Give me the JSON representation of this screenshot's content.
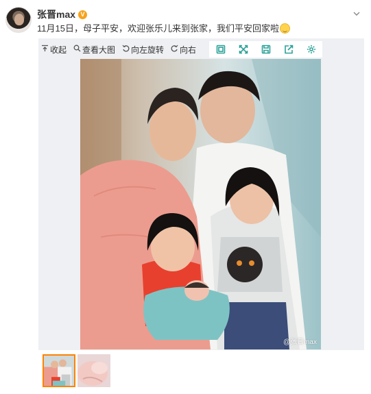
{
  "post": {
    "username": "张晋max",
    "verified_badge": "V",
    "text": "11月15日，母子平安，欢迎张乐儿来到张家，我们平安回家啦",
    "emoji": "smile-emoji"
  },
  "toolbar": {
    "collapse_label": "收起",
    "view_large_label": "查看大图",
    "rotate_left_label": "向左旋转",
    "rotate_right_label": "向右"
  },
  "photo": {
    "watermark": "@张晋max"
  },
  "icons": {
    "toolbar": [
      "collapse-icon",
      "zoom-icon",
      "rotate-left-icon",
      "rotate-right-icon"
    ],
    "icon_bar": [
      "frame-icon",
      "expand-icon",
      "save-icon",
      "share-icon",
      "settings-icon"
    ],
    "header": [
      "avatar",
      "verified-icon",
      "chevron-down-icon"
    ]
  },
  "colors": {
    "accent": "#2aa198",
    "badge": "#f7a21b",
    "thumb_active": "#ff8200",
    "panel_bg": "#eef0f3"
  },
  "thumbnails": [
    {
      "active": true
    },
    {
      "active": false
    }
  ]
}
